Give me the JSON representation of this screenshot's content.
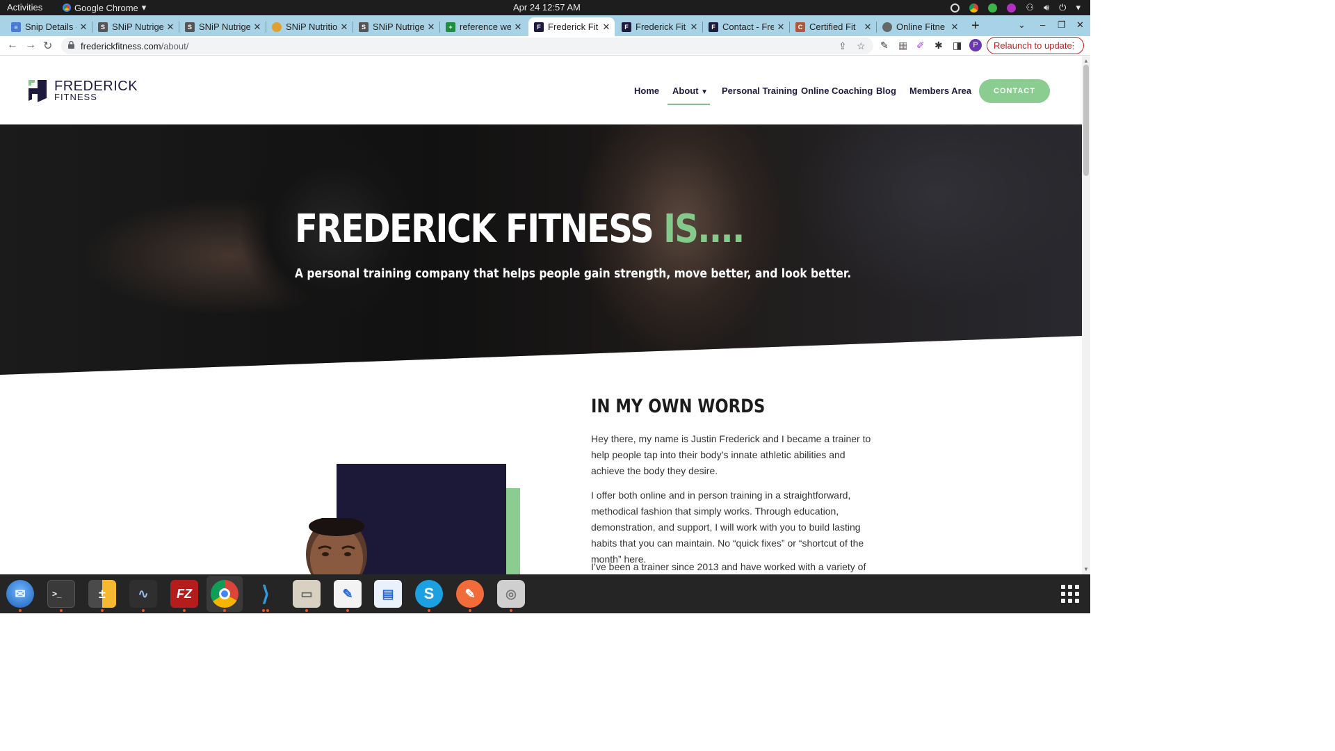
{
  "system_bar": {
    "activities": "Activities",
    "app_name": "Google Chrome",
    "clock": "Apr 24  12:57 AM"
  },
  "tabs": [
    {
      "title": "Snip Details -",
      "icon": "doc-icon",
      "color": "#4a7bd4"
    },
    {
      "title": "SNiP Nutrige",
      "icon": "snip-icon",
      "color": "#555555"
    },
    {
      "title": "SNiP Nutrige",
      "icon": "snip-icon",
      "color": "#555555"
    },
    {
      "title": "SNiP Nutritio",
      "icon": "pie-icon",
      "color": "#e0a030"
    },
    {
      "title": "SNiP Nutrige",
      "icon": "snip-icon",
      "color": "#555555"
    },
    {
      "title": "reference we",
      "icon": "sheets-icon",
      "color": "#1e8e3e"
    },
    {
      "title": "Frederick Fit",
      "icon": "frederick-icon",
      "color": "#1e1a3d",
      "active": true
    },
    {
      "title": "Frederick Fit",
      "icon": "frederick-icon",
      "color": "#1e1a3d"
    },
    {
      "title": "Contact - Fre",
      "icon": "frederick-icon",
      "color": "#1e1a3d"
    },
    {
      "title": "Certified Fit",
      "icon": "cert-icon",
      "color": "#b0563a"
    },
    {
      "title": "Online Fitne",
      "icon": "globe-icon",
      "color": "#666666"
    }
  ],
  "address_bar": {
    "domain": "frederickfitness.com",
    "path": "/about/",
    "relaunch_label": "Relaunch to update",
    "profile_initial": "P"
  },
  "site": {
    "logo": {
      "line1": "FREDERICK",
      "line2": "FITNESS"
    },
    "nav": [
      "Home",
      "About",
      "Personal Training",
      "Online Coaching",
      "Blog",
      "Members Area"
    ],
    "contact_button": "CONTACT",
    "hero": {
      "title_main": "FREDERICK FITNESS",
      "title_accent": "IS....",
      "subtitle": "A personal training company that helps people gain strength, move better, and look better."
    },
    "section_title": "IN MY OWN WORDS",
    "paragraphs": [
      "Hey there, my name is Justin Frederick and I became a trainer to help people tap into their body’s innate athletic abilities and achieve the body they desire.",
      "I offer both online and in person training in a straightforward, methodical fashion that simply works. Through education, demonstration, and support, I will work with you to build lasting habits that you can maintain. No “quick fixes” or “shortcut of the month” here.",
      "I’ve been a trainer since 2013 and have worked with a variety of"
    ],
    "colors": {
      "brand_navy": "#1e1a3d",
      "brand_green": "#85c98b"
    }
  },
  "dock": [
    "thunderbird-icon",
    "terminal-icon",
    "calculator-icon",
    "system-monitor-icon",
    "filezilla-icon",
    "chrome-icon",
    "vscode-icon",
    "files-icon",
    "text-editor-icon",
    "writer-icon",
    "skype-icon",
    "postman-icon",
    "disk-icon"
  ]
}
